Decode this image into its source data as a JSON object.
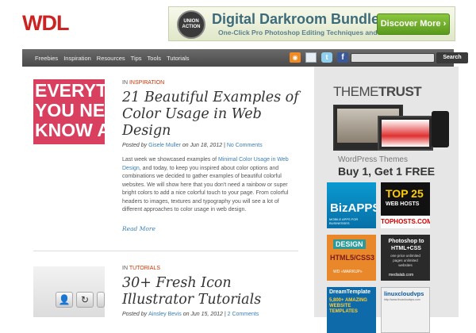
{
  "logo": "WDL",
  "top_ad": {
    "seal": "UNION ACTION",
    "title": "Digital Darkroom Bundle",
    "subtitle": "One-Click Pro Photoshop Editing Techniques and Effects",
    "button": "Discover More ›"
  },
  "nav": {
    "items": [
      "Freebies",
      "Inspiration",
      "Resources",
      "Tips",
      "Tools",
      "Tutorials"
    ],
    "search_label": "Search"
  },
  "icons": [
    "rss-icon",
    "mail-icon",
    "twitter-icon",
    "facebook-icon"
  ],
  "posts": [
    {
      "thumb_lines": [
        "EVERYT",
        "YOU NE",
        "KNOW A"
      ],
      "category_prefix": "IN",
      "category": "INSPIRATION",
      "title": "21 Beautiful Examples of Color Usage in Web Design",
      "meta_prefix": "Posted by",
      "author": "Gisele Muller",
      "meta_on": "on Jun 18, 2012 |",
      "comments": "No Comments",
      "excerpt_start": "Last week we showcased examples of ",
      "excerpt_link": "Minimal Color Usage in Web Design",
      "excerpt_rest": ", and today, to keep you inspired about color options and combinations we decided to gather examples of beautiful colorful websites. We will show here that you don't need a rainbow or super bright colors to add a nice colorful touch to your page. From colorful headers to images, textures and typography you will see a lot of different approaches to color usage in web design.",
      "read_more": "Read More"
    },
    {
      "category_prefix": "IN",
      "category": "TUTORIALS",
      "title": "30+ Fresh Icon Illustrator Tutorials",
      "meta_prefix": "Posted by",
      "author": "Ainsley Bevis",
      "meta_on": "on Jun 15, 2012 |",
      "comments": "2 Comments"
    }
  ],
  "sidebar": {
    "theme_trust_a": "THEME",
    "theme_trust_b": "TRUST",
    "tt_line1": "WordPress Themes",
    "tt_line2": "Buy 1, Get 1 FREE",
    "ads": [
      {
        "main": "BizAPPS",
        "sub": "MOBILE APPS FOR BUSINESSES"
      },
      {
        "main": "TOP 25",
        "sub": "WEB HOSTS",
        "foot": "TOPHOSTS.COM"
      },
      {
        "main": "DESIGN",
        "sub": "HTML5/CSS3",
        "foot": "WD «MARKUP»"
      },
      {
        "main": "Photoshop to HTML+CSS",
        "sub": "one price unlimited pages unlimited websites",
        "foot": "medialab.com"
      },
      {
        "main": "DreamTemplate",
        "sub": "5,800+ AMAZING WEBSITE TEMPLATES"
      },
      {
        "main": "linuxcloudvps",
        "sub": "http://www.linuxcloudvps.com"
      }
    ]
  },
  "colors": {
    "brand_red": "#cc2222",
    "link_blue": "#3b7fb8",
    "category_orange": "#cc3300",
    "navbar_gray": "#555555",
    "sidebar_bg": "#e6e6e6"
  }
}
